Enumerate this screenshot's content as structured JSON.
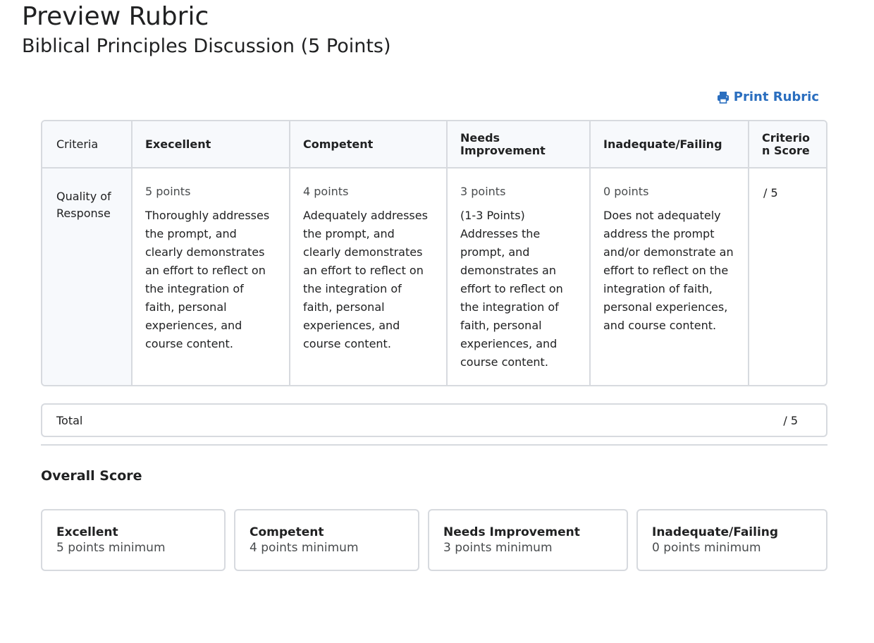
{
  "header": {
    "title": "Preview Rubric",
    "subtitle": "Biblical Principles Discussion (5 Points)"
  },
  "print": {
    "label": "Print Rubric",
    "icon": "printer-icon",
    "color": "#2a6ebf"
  },
  "rubric": {
    "columns": [
      "Criteria",
      "Execellent",
      "Competent",
      "Needs Improvement",
      "Inadequate/Failing",
      "Criterion Score"
    ],
    "criterion": {
      "name": "Quality of Response",
      "score": "/ 5",
      "levels": [
        {
          "points": "5 points",
          "desc": "Thoroughly addresses the prompt, and clearly demonstrates an effort to reflect on the integration of faith, personal experiences, and course content."
        },
        {
          "points": "4 points",
          "desc": "Adequately addresses the prompt, and clearly demonstrates an effort to reflect on the integration of faith, personal experiences, and course content."
        },
        {
          "points": "3 points",
          "desc": "(1-3 Points) Addresses the prompt, and demonstrates an effort to reflect on the integration of faith, personal experiences, and course content."
        },
        {
          "points": "0 points",
          "desc": "Does not adequately address the prompt and/or demonstrate an effort to reflect on the integration of faith, personal experiences, and course content."
        }
      ]
    }
  },
  "total": {
    "label": "Total",
    "score": "/ 5"
  },
  "overall": {
    "title": "Overall Score",
    "levels": [
      {
        "name": "Excellent",
        "min": "5 points minimum"
      },
      {
        "name": "Competent",
        "min": "4 points minimum"
      },
      {
        "name": "Needs Improvement",
        "min": "3 points minimum"
      },
      {
        "name": "Inadequate/Failing",
        "min": "0 points minimum"
      }
    ]
  },
  "colors": {
    "border": "#d7dadf",
    "header_bg": "#f7f9fc",
    "link": "#2a6ebf"
  }
}
